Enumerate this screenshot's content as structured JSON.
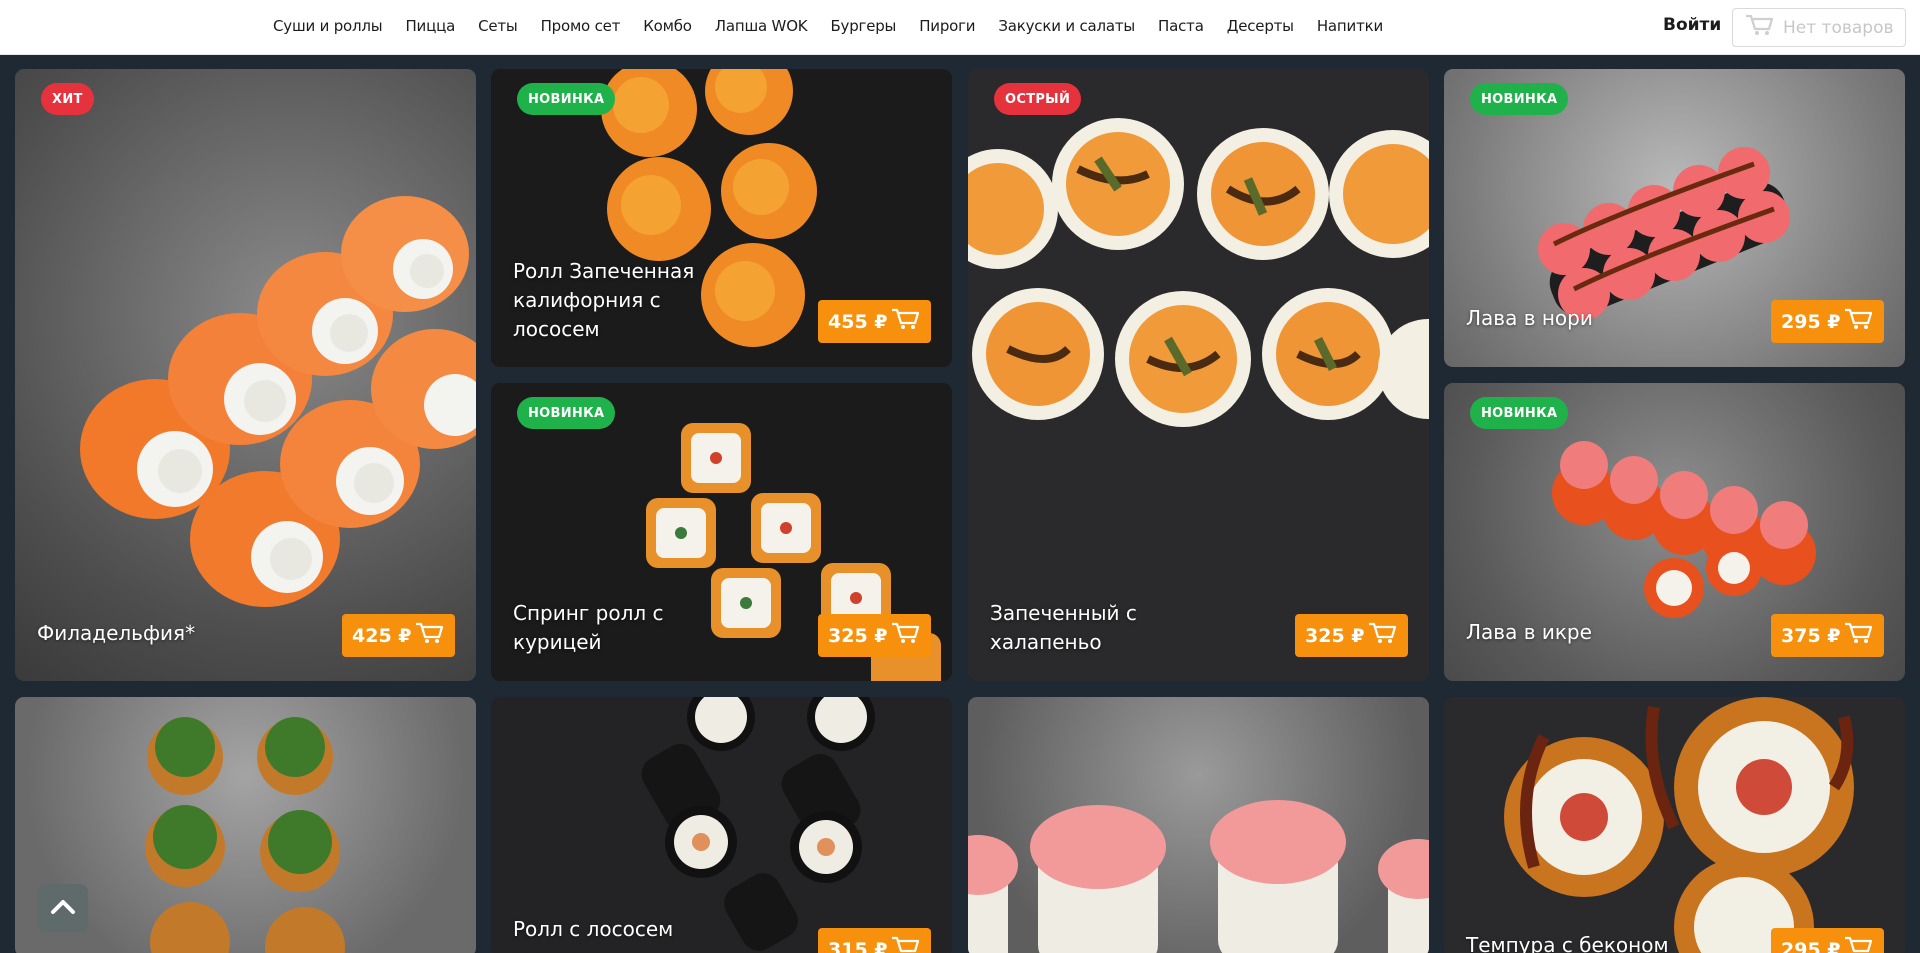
{
  "nav": {
    "items": [
      "Суши и роллы",
      "Пицца",
      "Сеты",
      "Промо сет",
      "Комбо",
      "Лапша WOK",
      "Бургеры",
      "Пироги",
      "Закуски и салаты",
      "Паста",
      "Десерты",
      "Напитки"
    ]
  },
  "header": {
    "login_label": "Войти",
    "cart_label": "Нет товаров"
  },
  "products": [
    {
      "name": "Филадельфия*",
      "price": "425 ₽",
      "badge": "ХИТ",
      "badge_color": "#e6323c"
    },
    {
      "name": "Ролл Запеченная калифорния с лососем",
      "price": "455 ₽",
      "badge": "НОВИНКА",
      "badge_color": "#20b24a"
    },
    {
      "name": "Запеченный с халапеньо",
      "price": "325 ₽",
      "badge": "ОСТРЫЙ",
      "badge_color": "#e6323c"
    },
    {
      "name": "Лава в нори",
      "price": "295 ₽",
      "badge": "НОВИНКА",
      "badge_color": "#20b24a"
    },
    {
      "name": "Спринг ролл с курицей",
      "price": "325 ₽",
      "badge": "НОВИНКА",
      "badge_color": "#20b24a"
    },
    {
      "name": "Лава в икре",
      "price": "375 ₽",
      "badge": "НОВИНКА",
      "badge_color": "#20b24a"
    },
    {
      "name": "Ролл с лососем терияки",
      "price": "315 ₽",
      "badge": "",
      "badge_color": ""
    },
    {
      "name": "Темпура с беконом",
      "price": "295 ₽",
      "badge": "",
      "badge_color": ""
    }
  ],
  "colors": {
    "price_button": "#f7910d",
    "page_bg": "#1f2933"
  },
  "icons": {
    "cart": "cart-icon",
    "scroll_up": "chevron-up-icon"
  }
}
